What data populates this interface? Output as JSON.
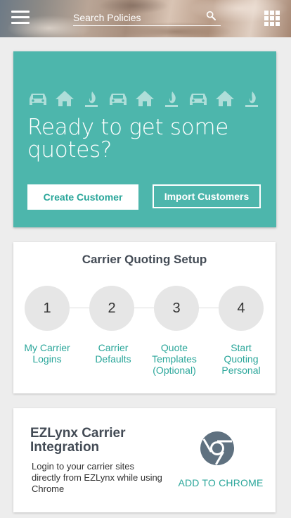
{
  "header": {
    "search_placeholder": "Search Policies",
    "icons": {
      "menu": "hamburger-menu-icon",
      "search": "search-icon",
      "apps": "apps-grid-icon"
    }
  },
  "hero": {
    "title": "Ready to get some quotes?",
    "icon_sequence": [
      "car-icon",
      "home-icon",
      "flame-icon",
      "car-icon",
      "home-icon",
      "flame-icon",
      "car-icon",
      "home-icon",
      "flame-icon"
    ],
    "create_customer_label": "Create Customer",
    "import_customers_label": "Import Customers",
    "colors": {
      "background": "#4db6ac",
      "accent": "#2aa69a"
    }
  },
  "setup": {
    "title": "Carrier Quoting Setup",
    "steps": [
      {
        "number": "1",
        "label": "My Carrier Logins"
      },
      {
        "number": "2",
        "label": "Carrier Defaults"
      },
      {
        "number": "3",
        "label": "Quote Templates (Optional)"
      },
      {
        "number": "4",
        "label": "Start Quoting Personal"
      }
    ]
  },
  "ezlynx": {
    "title": "EZLynx Carrier Integration",
    "description": "Login to your carrier sites directly from EZLynx while using Chrome",
    "icon": "chrome-logo-icon",
    "add_label": "ADD TO CHROME"
  }
}
